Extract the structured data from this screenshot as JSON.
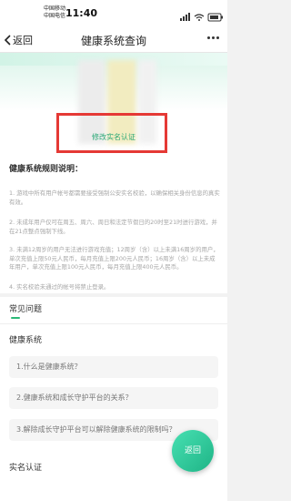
{
  "status_bar": {
    "carrier_1": "中国移动",
    "carrier_2": "中国电信",
    "time": "11:40",
    "icons": [
      "signal-icon",
      "wifi-icon",
      "battery-icon"
    ]
  },
  "nav": {
    "back_label": "返回",
    "title": "健康系统查询"
  },
  "hero": {
    "verify_link": "修改实名认证"
  },
  "rules": {
    "title": "健康系统规则说明：",
    "items": [
      "1. 游戏中所有用户帐号都需要接受强制公安实名校验，以确保相关身份信息的真实有效。",
      "2. 未成年用户仅可在周五、周六、周日和法定节假日的20时至21时进行游戏，并在21点整点强制下线。",
      "3. 未满12周岁的用户无法进行游戏充值；12周岁（含）以上未满16周岁的用户，单次充值上限50元人民币，每月充值上限200元人民币；16周岁（含）以上未成年用户，单次充值上限100元人民币，每月充值上限400元人民币。",
      "4. 实名校验未通过的帐号将禁止登录。"
    ]
  },
  "faq": {
    "title": "常见问题",
    "sections": [
      {
        "title": "健康系统",
        "questions": [
          "1.什么是健康系统？",
          "2.健康系统和成长守护平台的关系？",
          "3.解除成长守护平台可以解除健康系统的限制吗？"
        ]
      },
      {
        "title": "实名认证",
        "questions": []
      }
    ]
  },
  "float_button": {
    "label": "返回"
  },
  "colors": {
    "accent": "#2bb877",
    "highlight": "#e53935"
  }
}
